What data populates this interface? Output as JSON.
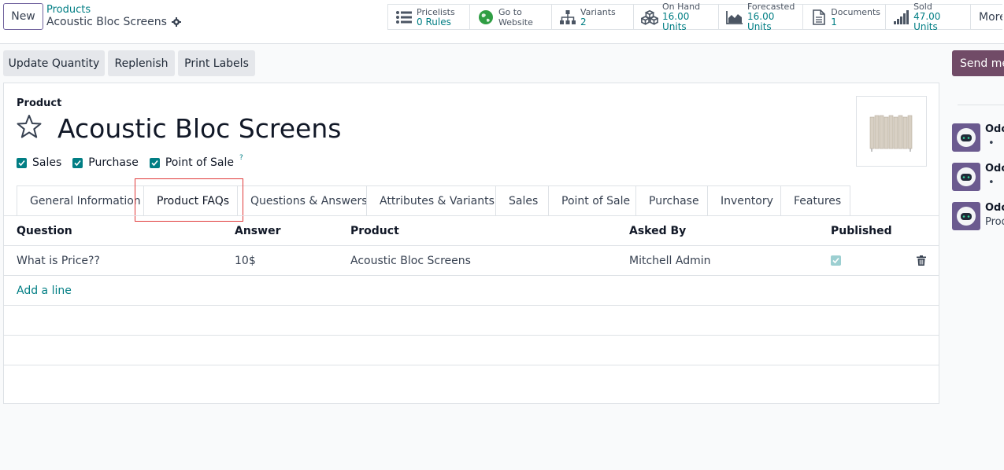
{
  "header": {
    "new_label": "New",
    "breadcrumb": "Products",
    "record_name": "Acoustic Bloc Screens"
  },
  "smart_buttons": [
    {
      "line1": "Pricelists",
      "line2": "0 Rules",
      "icon": "list-icon"
    },
    {
      "line1": "Go to",
      "line2": "Website",
      "icon": "globe-icon"
    },
    {
      "line1": "Variants",
      "line2": "2",
      "icon": "sitemap-icon"
    },
    {
      "line1": "On Hand",
      "line2": "16.00 Units",
      "icon": "cubes-icon"
    },
    {
      "line1": "Forecasted",
      "line2": "16.00 Units",
      "icon": "area-chart-icon"
    },
    {
      "line1": "Documents",
      "line2": "1",
      "icon": "document-icon"
    },
    {
      "line1": "Sold",
      "line2": "47.00 Units",
      "icon": "signal-icon"
    }
  ],
  "more_label": "More",
  "actions": {
    "update_quantity": "Update Quantity",
    "replenish": "Replenish",
    "print_labels": "Print Labels",
    "send_message": "Send message"
  },
  "form": {
    "product_label": "Product",
    "product_name": "Acoustic Bloc Screens",
    "checkboxes": {
      "sales": "Sales",
      "purchase": "Purchase",
      "pos": "Point of Sale",
      "pos_help": "?"
    }
  },
  "tabs": [
    "General Information",
    "Product FAQs",
    "Questions & Answers",
    "Attributes & Variants",
    "Sales",
    "Point of Sale",
    "Purchase",
    "Inventory",
    "Features"
  ],
  "faq_table": {
    "columns": [
      "Question",
      "Answer",
      "Product",
      "Asked By",
      "Published"
    ],
    "rows": [
      {
        "question": "What is Price??",
        "answer": "10$",
        "product": "Acoustic Bloc Screens",
        "asked_by": "Mitchell Admin",
        "published": true
      }
    ],
    "add_line": "Add a line"
  },
  "chatter": {
    "messages": [
      {
        "author": "OdooBot",
        "body": "•"
      },
      {
        "author": "OdooBot",
        "body": "•"
      },
      {
        "author": "OdooBot",
        "body": "Product created"
      }
    ]
  },
  "colors": {
    "primary": "#714b67",
    "link": "#017e84",
    "highlight": "#e03a3a"
  }
}
